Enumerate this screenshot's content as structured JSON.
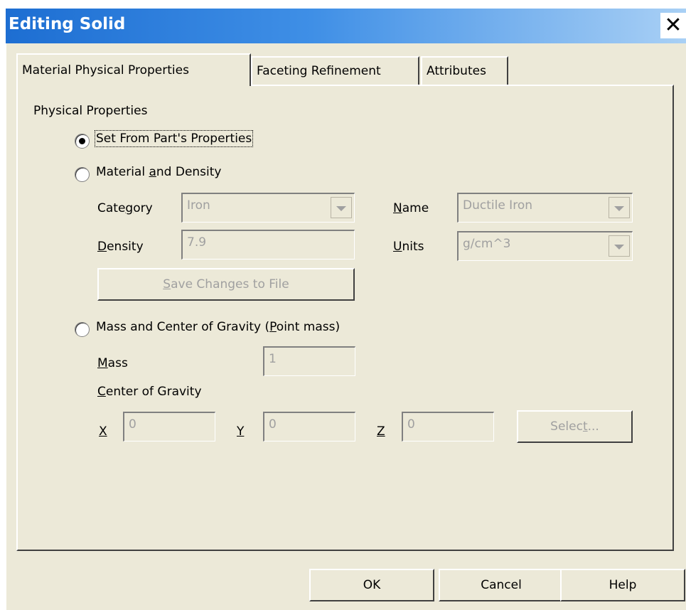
{
  "window": {
    "title": "Editing Solid",
    "close_glyph": "✕"
  },
  "tabs": [
    {
      "label": "Material Physical Properties",
      "active": true
    },
    {
      "label": "Faceting Refinement",
      "active": false
    },
    {
      "label": "Attributes",
      "active": false
    }
  ],
  "group_title": "Physical Properties",
  "options": {
    "set_from_part": "Set From Part's Properties",
    "material_density": {
      "pre": "Material ",
      "ul": "a",
      "post": "nd Density"
    },
    "mass_cog": {
      "pre": "Mass and Center of Gravity (",
      "ul": "P",
      "post": "oint mass)"
    }
  },
  "selected_option": "set_from_part",
  "material": {
    "category_label": {
      "pre": "Cate",
      "ul": "g",
      "post": "ory"
    },
    "category_value": "Iron",
    "name_label": {
      "pre": "",
      "ul": "N",
      "post": "ame"
    },
    "name_value": "Ductile Iron",
    "density_label": {
      "pre": "",
      "ul": "D",
      "post": "ensity"
    },
    "density_value": "7.9",
    "units_label": {
      "pre": "",
      "ul": "U",
      "post": "nits"
    },
    "units_value": "g/cm^3",
    "save_button": {
      "pre": "",
      "ul": "S",
      "post": "ave Changes to File"
    }
  },
  "mass": {
    "mass_label": {
      "pre": "",
      "ul": "M",
      "post": "ass"
    },
    "mass_value": "1",
    "cog_label": {
      "pre": "",
      "ul": "C",
      "post": "enter of Gravity"
    },
    "x_label": "X",
    "x_value": "0",
    "y_label": "Y",
    "y_value": "0",
    "z_label": "Z",
    "z_value": "0",
    "select_button": {
      "pre": "Selec",
      "ul": "t",
      "post": "..."
    }
  },
  "buttons": {
    "ok": "OK",
    "cancel": "Cancel",
    "help": "Help"
  },
  "colors": {
    "titlebar_start": "#1d6ed2",
    "titlebar_end": "#a9d0f5",
    "dialog_bg": "#ece9d8",
    "disabled_text": "#a0a0a0"
  }
}
